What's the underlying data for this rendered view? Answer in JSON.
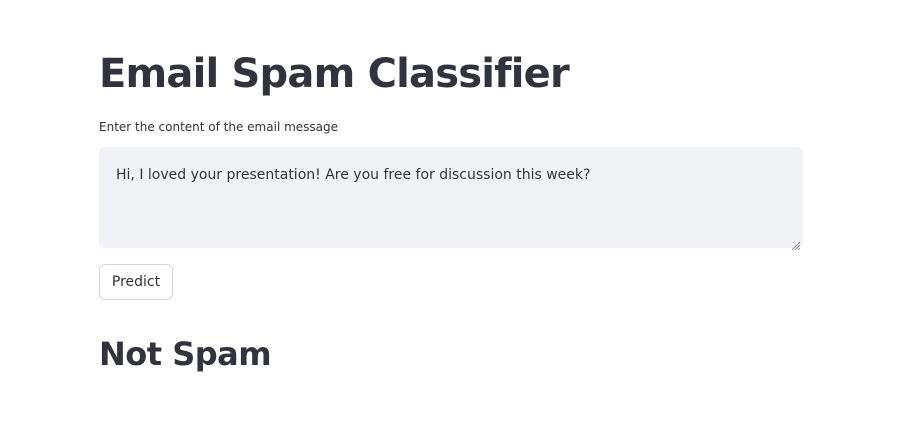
{
  "app": {
    "title": "Email Spam Classifier"
  },
  "form": {
    "label": "Enter the content of the email message",
    "message_value": "Hi, I loved your presentation! Are you free for discussion this week?",
    "resize_icon": "resize-grip-icon"
  },
  "actions": {
    "predict_label": "Predict"
  },
  "result": {
    "heading": "Not Spam"
  },
  "colors": {
    "text": "#31333f",
    "input_background": "#f0f2f6",
    "button_border": "#d6d6d9",
    "page_background": "#ffffff"
  }
}
